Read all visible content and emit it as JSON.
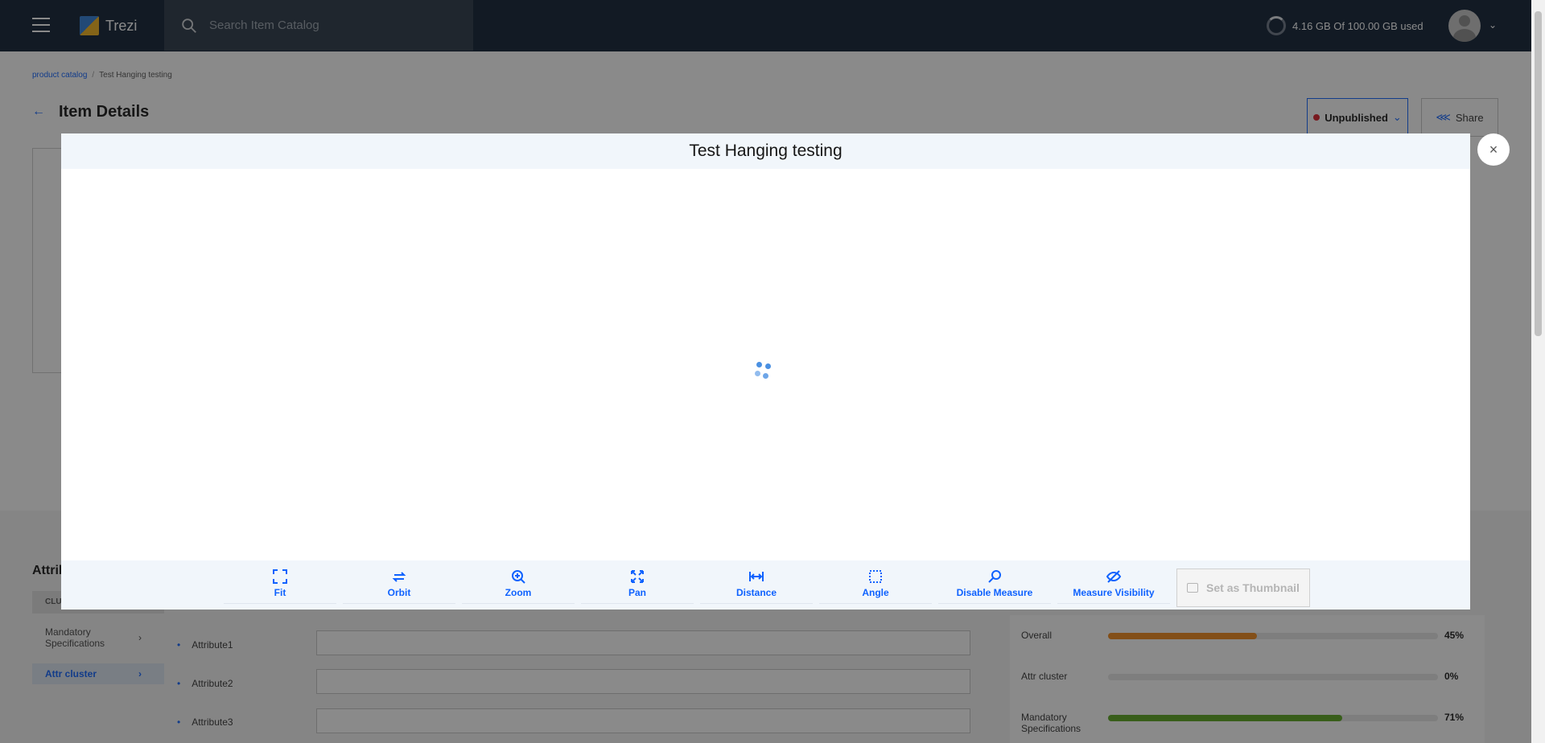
{
  "header": {
    "app_name": "Trezi",
    "search_placeholder": "Search Item Catalog",
    "storage_text": "4.16 GB Of 100.00 GB used"
  },
  "page": {
    "breadcrumb": [
      "product catalog",
      "Test Hanging testing"
    ],
    "title": "Item Details",
    "status_label": "Unpublished",
    "share_label": "Share",
    "attributes_heading": "Attrib",
    "cluster_header": "CLU",
    "clusters": [
      {
        "label": "Mandatory Specifications"
      },
      {
        "label": "Attr cluster"
      }
    ],
    "attributes": [
      "Attribute1",
      "Attribute2",
      "Attribute3"
    ],
    "progress": [
      {
        "label": "Overall",
        "value": 45,
        "value_label": "45%",
        "color": "#f0891b"
      },
      {
        "label": "Attr cluster",
        "value": 0,
        "value_label": "0%",
        "color": "#e6e6e6"
      },
      {
        "label": "Mandatory Specifications",
        "value": 71,
        "value_label": "71%",
        "color": "#5aa61f"
      }
    ]
  },
  "modal": {
    "title": "Test Hanging testing",
    "tools": [
      {
        "label": "Fit",
        "icon": "fit-icon"
      },
      {
        "label": "Orbit",
        "icon": "orbit-icon"
      },
      {
        "label": "Zoom",
        "icon": "zoom-icon"
      },
      {
        "label": "Pan",
        "icon": "pan-icon"
      },
      {
        "label": "Distance",
        "icon": "distance-icon"
      },
      {
        "label": "Angle",
        "icon": "angle-icon"
      },
      {
        "label": "Disable Measure",
        "icon": "measure-icon"
      },
      {
        "label": "Measure Visibility",
        "icon": "eye-off-icon"
      }
    ],
    "thumbnail_label": "Set as Thumbnail",
    "close_label": "×"
  }
}
